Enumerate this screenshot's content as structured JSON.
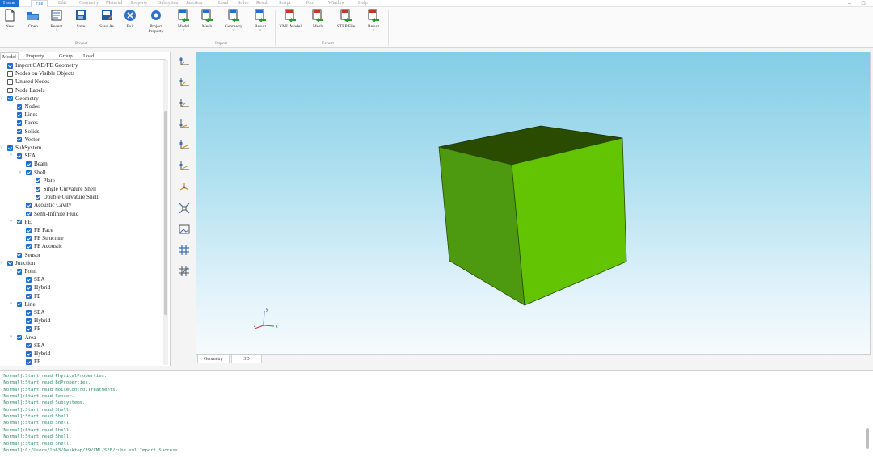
{
  "menubar": {
    "items": [
      "Home",
      "File",
      "Edit",
      "Geometry",
      "Material",
      "Property",
      "Subsystem",
      "Junction",
      "Load",
      "Solve",
      "Result",
      "Script",
      "Tool",
      "Window",
      "Help"
    ],
    "active": "File",
    "window_controls": [
      "–",
      "□"
    ]
  },
  "ribbon": {
    "buttons": [
      {
        "label": "New",
        "icon": "new-file-icon"
      },
      {
        "label": "Open",
        "icon": "open-folder-icon"
      },
      {
        "label": "Recent",
        "icon": "recent-files-icon",
        "dropdown": true
      },
      {
        "label": "Save",
        "icon": "save-icon"
      },
      {
        "label": "Save As",
        "icon": "save-as-icon"
      },
      {
        "label": "Exit",
        "icon": "exit-icon"
      },
      {
        "label": "Project",
        "label2": "Property",
        "icon": "project-property-icon"
      },
      {
        "label": "Model",
        "icon": "import-model-icon",
        "dropdown": true
      },
      {
        "label": "Mesh",
        "icon": "import-mesh-icon"
      },
      {
        "label": "Geometry",
        "icon": "import-geometry-icon",
        "dropdown": true
      },
      {
        "label": "Result",
        "icon": "import-result-icon",
        "dropdown": true
      },
      {
        "label": "XML Model",
        "icon": "export-xml-model-icon"
      },
      {
        "label": "Mesh",
        "icon": "export-mesh-icon"
      },
      {
        "label": "STEP File",
        "icon": "export-step-icon"
      },
      {
        "label": "Result",
        "icon": "export-result-icon",
        "dropdown": true
      }
    ],
    "groups": [
      "Project",
      "Import",
      "Export"
    ]
  },
  "left_panel": {
    "tabs": [
      "Model",
      "Property",
      "Group",
      "Load"
    ],
    "selected_tab": "Model"
  },
  "tree": [
    {
      "label": "Import CAD/FE Geometry",
      "level": 0,
      "checked": true,
      "arrow": ""
    },
    {
      "label": "Nodes on Visible Objects",
      "level": 0,
      "checked": false,
      "arrow": ""
    },
    {
      "label": "Unused Nodes",
      "level": 0,
      "checked": false,
      "arrow": ""
    },
    {
      "label": "Node Labels",
      "level": 0,
      "checked": false,
      "arrow": ""
    },
    {
      "label": "Geometry",
      "level": 0,
      "checked": true,
      "arrow": "v"
    },
    {
      "label": "Nodes",
      "level": 1,
      "checked": true,
      "arrow": ""
    },
    {
      "label": "Lines",
      "level": 1,
      "checked": true,
      "arrow": ""
    },
    {
      "label": "Faces",
      "level": 1,
      "checked": true,
      "arrow": ""
    },
    {
      "label": "Solids",
      "level": 1,
      "checked": true,
      "arrow": ""
    },
    {
      "label": "Vector",
      "level": 1,
      "checked": true,
      "arrow": ""
    },
    {
      "label": "SubSystem",
      "level": 0,
      "checked": true,
      "arrow": "v"
    },
    {
      "label": "SEA",
      "level": 1,
      "checked": true,
      "arrow": "v"
    },
    {
      "label": "Beam",
      "level": 2,
      "checked": true,
      "arrow": ""
    },
    {
      "label": "Shell",
      "level": 2,
      "checked": true,
      "arrow": "v"
    },
    {
      "label": "Plate",
      "level": 3,
      "checked": true,
      "arrow": ""
    },
    {
      "label": "Single Curvature Shell",
      "level": 3,
      "checked": true,
      "arrow": ""
    },
    {
      "label": "Double Curvature Shell",
      "level": 3,
      "checked": true,
      "arrow": ""
    },
    {
      "label": "Acoustic Cavity",
      "level": 2,
      "checked": true,
      "arrow": ""
    },
    {
      "label": "Semi-Infinite Fluid",
      "level": 2,
      "checked": true,
      "arrow": ""
    },
    {
      "label": "FE",
      "level": 1,
      "checked": true,
      "arrow": "v"
    },
    {
      "label": "FE Face",
      "level": 2,
      "checked": true,
      "arrow": ""
    },
    {
      "label": "FE Structure",
      "level": 2,
      "checked": true,
      "arrow": ""
    },
    {
      "label": "FE Acoustic",
      "level": 2,
      "checked": true,
      "arrow": ""
    },
    {
      "label": "Sensor",
      "level": 1,
      "checked": true,
      "arrow": ""
    },
    {
      "label": "Junction",
      "level": 0,
      "checked": true,
      "arrow": "v"
    },
    {
      "label": "Point",
      "level": 1,
      "checked": true,
      "arrow": "v"
    },
    {
      "label": "SEA",
      "level": 2,
      "checked": true,
      "arrow": ""
    },
    {
      "label": "Hybrid",
      "level": 2,
      "checked": true,
      "arrow": ""
    },
    {
      "label": "FE",
      "level": 2,
      "checked": true,
      "arrow": ""
    },
    {
      "label": "Line",
      "level": 1,
      "checked": true,
      "arrow": "v"
    },
    {
      "label": "SEA",
      "level": 2,
      "checked": true,
      "arrow": ""
    },
    {
      "label": "Hybrid",
      "level": 2,
      "checked": true,
      "arrow": ""
    },
    {
      "label": "FE",
      "level": 2,
      "checked": true,
      "arrow": ""
    },
    {
      "label": "Area",
      "level": 1,
      "checked": true,
      "arrow": "v"
    },
    {
      "label": "SEA",
      "level": 2,
      "checked": true,
      "arrow": ""
    },
    {
      "label": "Hybrid",
      "level": 2,
      "checked": true,
      "arrow": ""
    },
    {
      "label": "FE",
      "level": 2,
      "checked": true,
      "arrow": ""
    }
  ],
  "vtoolbar": {
    "icons": [
      "view-front-icon",
      "view-back-icon",
      "view-left-icon",
      "view-right-icon",
      "view-top-icon",
      "view-bottom-icon",
      "view-isometric-icon",
      "fit-all-icon",
      "screenshot-icon",
      "grid-icon",
      "mesh-grid-icon"
    ]
  },
  "viewport": {
    "colors": {
      "top_face": "#2a4c00",
      "left_face": "#4d9a10",
      "right_face": "#62c402"
    },
    "axes": {
      "x": "x",
      "y": "y",
      "z": "z"
    },
    "tabs": [
      "Geometry",
      "3D"
    ]
  },
  "log": [
    "[Normal]:Start read PhysicalProperties.",
    "[Normal]:Start read BdProperties.",
    "[Normal]:Start read NoiseControlTreatments.",
    "[Normal]:Start read Sensor.",
    "[Normal]:Start read Subsystems.",
    "[Normal]:Start read Shell.",
    "[Normal]:Start read Shell.",
    "[Normal]:Start read Shell.",
    "[Normal]:Start read Shell.",
    "[Normal]:Start read Shell.",
    "[Normal]:Start read Shell.",
    "[Normal]:C:/Users/lb63/Desktop/39/XML/SEE/cube.xml Import Success."
  ]
}
